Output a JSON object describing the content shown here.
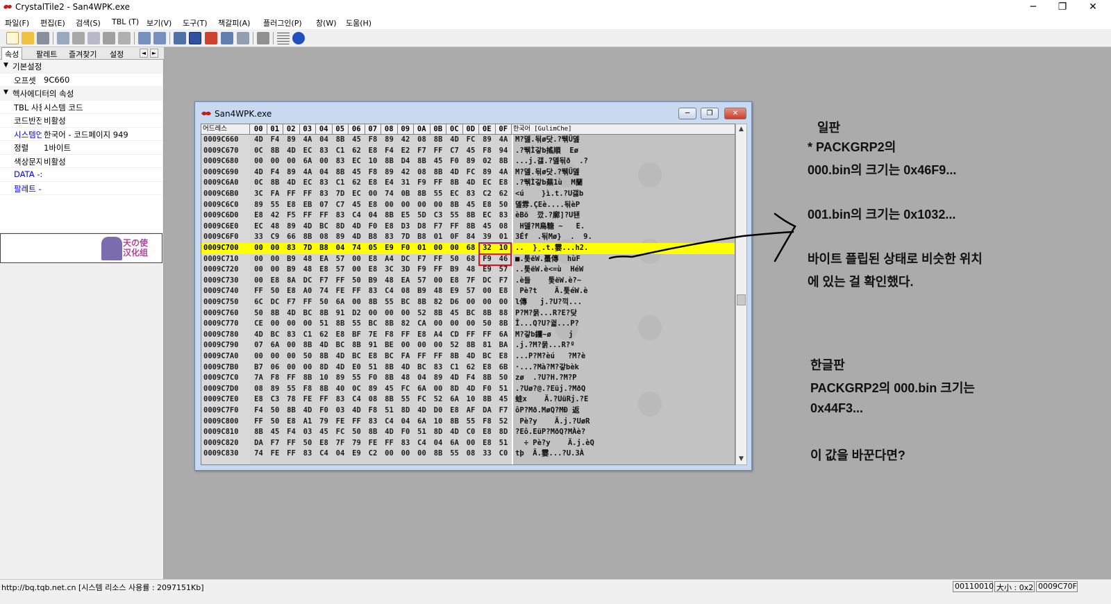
{
  "window": {
    "title": "CrystalTile2 - San4WPK.exe",
    "controls": [
      "─",
      "❐",
      "✕"
    ]
  },
  "menu": [
    "파일(F)",
    "편집(E)",
    "검색(S)",
    "TBL (T)",
    "보기(V)",
    "도구(T)",
    "책갈피(A)",
    "플러그인(P)",
    "창(W)",
    "도움(H)"
  ],
  "toolbar": {
    "icons": [
      "new-file-icon",
      "open-folder-icon",
      "save-icon",
      "undo-icon",
      "cut-icon",
      "copy-icon",
      "paste-icon",
      "delete-icon",
      "import-icon",
      "export-icon",
      "tile-view-icon",
      "hex-view-icon",
      "text-view-icon",
      "edit-icon",
      "search-icon",
      "print-icon",
      "grid-icon",
      "help-icon"
    ]
  },
  "left_panel": {
    "tabs": [
      "속성",
      "팔레트",
      "즐겨찾기",
      "설정"
    ],
    "tab_arrows": [
      "◄",
      "►"
    ],
    "rows": [
      {
        "type": "category",
        "label": "기본설정"
      },
      {
        "type": "prop",
        "key": "오프셋",
        "value": "9C660"
      },
      {
        "type": "category",
        "label": "헥사에디터의 속성"
      },
      {
        "type": "prop",
        "key": "TBL 사용",
        "value": "시스템 코드"
      },
      {
        "type": "prop",
        "key": "코드반전",
        "value": "비활성"
      },
      {
        "type": "prop",
        "key": "시스템언어",
        "value": "한국어    - 코드페이지 949",
        "link": true
      },
      {
        "type": "prop",
        "key": "정렬",
        "value": "1바이트"
      },
      {
        "type": "prop",
        "key": "색상문자",
        "value": "비활성"
      },
      {
        "type": "single",
        "key": "DATA -:",
        "link": true
      },
      {
        "type": "single",
        "key": "팔레트 -",
        "link": true
      }
    ],
    "logo_text": [
      "天の使",
      "汉化组"
    ]
  },
  "status": {
    "text": "http://bq.tqb.net.cn [시스템 리소스 사용률 : 2097151Kb]",
    "cells": [
      "00110010",
      "大小 : 0x2",
      "0009C70F"
    ]
  },
  "child_window": {
    "title": "San4WPK.exe",
    "header": {
      "address_label": "어드레스",
      "columns": [
        "00",
        "01",
        "02",
        "03",
        "04",
        "05",
        "06",
        "07",
        "08",
        "09",
        "0A",
        "0B",
        "0C",
        "0D",
        "0E",
        "0F"
      ],
      "text_label": "한국어 [GulimChe]"
    },
    "rows": [
      {
        "addr": "0009C660",
        "bytes": [
          "4D",
          "F4",
          "89",
          "4A",
          "04",
          "8B",
          "45",
          "F8",
          "89",
          "42",
          "08",
          "8B",
          "4D",
          "FC",
          "89",
          "4A"
        ],
        "text": "M?뎶.됚ø닷.?뛖Ü뎶"
      },
      {
        "addr": "0009C670",
        "bytes": [
          "0C",
          "8B",
          "4D",
          "EC",
          "83",
          "C1",
          "62",
          "E8",
          "F4",
          "E2",
          "F7",
          "FF",
          "C7",
          "45",
          "F8",
          "94"
        ],
        "text": ".?뛖Ì갛b搖順  Eø"
      },
      {
        "addr": "0009C680",
        "bytes": [
          "00",
          "00",
          "00",
          "6A",
          "00",
          "83",
          "EC",
          "10",
          "8B",
          "D4",
          "8B",
          "45",
          "F0",
          "89",
          "02",
          "8B"
        ],
        "text": "...j.갫.?뎶됚ð  .?"
      },
      {
        "addr": "0009C690",
        "bytes": [
          "4D",
          "F4",
          "89",
          "4A",
          "04",
          "8B",
          "45",
          "F8",
          "89",
          "42",
          "08",
          "8B",
          "4D",
          "FC",
          "89",
          "4A"
        ],
        "text": "M?뎶.됚ø닷.?뛖Ü뎶"
      },
      {
        "addr": "0009C6A0",
        "bytes": [
          "0C",
          "8B",
          "4D",
          "EC",
          "83",
          "C1",
          "62",
          "E8",
          "E4",
          "31",
          "F9",
          "FF",
          "8B",
          "4D",
          "EC",
          "E8"
        ],
        "text": ".?뛖Ì갛b蕪1ù  M蘭"
      },
      {
        "addr": "0009C6B0",
        "bytes": [
          "3C",
          "FA",
          "FF",
          "FF",
          "83",
          "7D",
          "EC",
          "00",
          "74",
          "0B",
          "8B",
          "55",
          "EC",
          "83",
          "C2",
          "62"
        ],
        "text": "<ú    }ì.t.?U갫b"
      },
      {
        "addr": "0009C6C0",
        "bytes": [
          "89",
          "55",
          "E8",
          "EB",
          "07",
          "C7",
          "45",
          "E8",
          "00",
          "00",
          "00",
          "00",
          "8B",
          "45",
          "E8",
          "50"
        ],
        "text": "뎶雰.ÇEè....됚èP"
      },
      {
        "addr": "0009C6D0",
        "bytes": [
          "E8",
          "42",
          "F5",
          "FF",
          "FF",
          "83",
          "C4",
          "04",
          "8B",
          "E5",
          "5D",
          "C3",
          "55",
          "8B",
          "EC",
          "83"
        ],
        "text": "èBõ  깠.?廓]?U됀"
      },
      {
        "addr": "0009C6E0",
        "bytes": [
          "EC",
          "48",
          "89",
          "4D",
          "BC",
          "8D",
          "4D",
          "F0",
          "E8",
          "D3",
          "D8",
          "F7",
          "FF",
          "8B",
          "45",
          "08"
        ],
        "text": " H뎶?M鳥糖 ~   E."
      },
      {
        "addr": "0009C6F0",
        "bytes": [
          "33",
          "C9",
          "66",
          "8B",
          "08",
          "89",
          "4D",
          "B8",
          "83",
          "7D",
          "B8",
          "01",
          "0F",
          "84",
          "39",
          "01"
        ],
        "text": "3Éf  .됚Mø}  .  9."
      },
      {
        "addr": "0009C700",
        "bytes": [
          "00",
          "00",
          "83",
          "7D",
          "B8",
          "04",
          "74",
          "05",
          "E9",
          "F0",
          "01",
          "00",
          "00",
          "68",
          "32",
          "10"
        ],
        "text": "..  }¸.t.霎...h2.",
        "hl": true
      },
      {
        "addr": "0009C710",
        "bytes": [
          "00",
          "00",
          "B9",
          "48",
          "EA",
          "57",
          "00",
          "E8",
          "A4",
          "DC",
          "F7",
          "FF",
          "50",
          "68",
          "F9",
          "46"
        ],
        "text": "■.퉃ëW.蠆傳  hùF"
      },
      {
        "addr": "0009C720",
        "bytes": [
          "00",
          "00",
          "B9",
          "48",
          "E8",
          "57",
          "00",
          "E8",
          "3C",
          "3D",
          "F9",
          "FF",
          "B9",
          "48",
          "E9",
          "57"
        ],
        "text": "..퉃ëW.è<=ù  HéW"
      },
      {
        "addr": "0009C730",
        "bytes": [
          "00",
          "E8",
          "8A",
          "DC",
          "F7",
          "FF",
          "50",
          "B9",
          "48",
          "EA",
          "57",
          "00",
          "E8",
          "7F",
          "DC",
          "F7"
        ],
        "text": ".è들    퉃ëW.è?~"
      },
      {
        "addr": "0009C740",
        "bytes": [
          "FF",
          "50",
          "E8",
          "A0",
          "74",
          "FE",
          "FF",
          "83",
          "C4",
          "08",
          "B9",
          "48",
          "E9",
          "57",
          "00",
          "E8"
        ],
        "text": " Pè?t    Ä.퉃éW.è"
      },
      {
        "addr": "0009C750",
        "bytes": [
          "6C",
          "DC",
          "F7",
          "FF",
          "50",
          "6A",
          "00",
          "8B",
          "55",
          "BC",
          "8B",
          "82",
          "D6",
          "00",
          "00",
          "00"
        ],
        "text": "l傳   j.?U?끽..."
      },
      {
        "addr": "0009C760",
        "bytes": [
          "50",
          "8B",
          "4D",
          "BC",
          "8B",
          "91",
          "D2",
          "00",
          "00",
          "00",
          "52",
          "8B",
          "45",
          "BC",
          "8B",
          "88"
        ],
        "text": "P?M?묽...R?E?닺"
      },
      {
        "addr": "0009C770",
        "bytes": [
          "CE",
          "00",
          "00",
          "00",
          "51",
          "8B",
          "55",
          "BC",
          "8B",
          "82",
          "CA",
          "00",
          "00",
          "00",
          "50",
          "8B"
        ],
        "text": "Î...Q?U?궓...P?"
      },
      {
        "addr": "0009C780",
        "bytes": [
          "4D",
          "BC",
          "83",
          "C1",
          "62",
          "E8",
          "BF",
          "7E",
          "F8",
          "FF",
          "E8",
          "A4",
          "CD",
          "FF",
          "FF",
          "6A"
        ],
        "text": "M?갛b钁~ø    j"
      },
      {
        "addr": "0009C790",
        "bytes": [
          "07",
          "6A",
          "00",
          "8B",
          "4D",
          "BC",
          "8B",
          "91",
          "BE",
          "00",
          "00",
          "00",
          "52",
          "8B",
          "81",
          "BA"
        ],
        "text": ".j.?M?묽...R?º"
      },
      {
        "addr": "0009C7A0",
        "bytes": [
          "00",
          "00",
          "00",
          "50",
          "8B",
          "4D",
          "BC",
          "E8",
          "BC",
          "FA",
          "FF",
          "FF",
          "8B",
          "4D",
          "BC",
          "E8"
        ],
        "text": "...P?M?èú   ?M?è"
      },
      {
        "addr": "0009C7B0",
        "bytes": [
          "B7",
          "06",
          "00",
          "00",
          "8D",
          "4D",
          "E0",
          "51",
          "8B",
          "4D",
          "BC",
          "83",
          "C1",
          "62",
          "E8",
          "6B"
        ],
        "text": "·...?Mà?M?갛bèk"
      },
      {
        "addr": "0009C7C0",
        "bytes": [
          "7A",
          "F8",
          "FF",
          "8B",
          "10",
          "89",
          "55",
          "F0",
          "8B",
          "48",
          "04",
          "89",
          "4D",
          "F4",
          "8B",
          "50"
        ],
        "text": "zø  .?U?H.?M?P"
      },
      {
        "addr": "0009C7D0",
        "bytes": [
          "08",
          "89",
          "55",
          "F8",
          "8B",
          "40",
          "0C",
          "89",
          "45",
          "FC",
          "6A",
          "00",
          "8D",
          "4D",
          "F0",
          "51"
        ],
        "text": ".?Uø?@.?Eüj.?MðQ"
      },
      {
        "addr": "0009C7E0",
        "bytes": [
          "E8",
          "C3",
          "78",
          "FE",
          "FF",
          "83",
          "C4",
          "08",
          "8B",
          "55",
          "FC",
          "52",
          "6A",
          "10",
          "8B",
          "45"
        ],
        "text": "蛙x    Ä.?UüRj.?E"
      },
      {
        "addr": "0009C7F0",
        "bytes": [
          "F4",
          "50",
          "8B",
          "4D",
          "F0",
          "03",
          "4D",
          "F8",
          "51",
          "8D",
          "4D",
          "D0",
          "E8",
          "AF",
          "DA",
          "F7"
        ],
        "text": "ôP?Mð.MøQ?MÐ 返"
      },
      {
        "addr": "0009C800",
        "bytes": [
          "FF",
          "50",
          "E8",
          "A1",
          "79",
          "FE",
          "FF",
          "83",
          "C4",
          "04",
          "6A",
          "10",
          "8B",
          "55",
          "F8",
          "52"
        ],
        "text": " Pè?y    Ä.j.?UøR"
      },
      {
        "addr": "0009C810",
        "bytes": [
          "8B",
          "45",
          "F4",
          "03",
          "45",
          "FC",
          "50",
          "8B",
          "4D",
          "F0",
          "51",
          "8D",
          "4D",
          "C0",
          "E8",
          "8D"
        ],
        "text": "?Eô.EüP?MðQ?MÀè?"
      },
      {
        "addr": "0009C820",
        "bytes": [
          "DA",
          "F7",
          "FF",
          "50",
          "E8",
          "7F",
          "79",
          "FE",
          "FF",
          "83",
          "C4",
          "04",
          "6A",
          "00",
          "E8",
          "51"
        ],
        "text": "  ÷ Pè?y    Ä.j.èQ"
      },
      {
        "addr": "0009C830",
        "bytes": [
          "74",
          "FE",
          "FF",
          "83",
          "C4",
          "04",
          "E9",
          "C2",
          "00",
          "00",
          "00",
          "8B",
          "55",
          "08",
          "33",
          "C0"
        ],
        "text": "tþ  Ä.霎...?U.3À"
      }
    ]
  },
  "annotations": {
    "jp_title": "일판",
    "jp_lines": [
      "* PACKGRP2의",
      "000.bin의 크기는 0x46F9...",
      "001.bin의 크기는 0x1032...",
      "바이트 플립된 상태로 비슷한 위치",
      "에 있는 걸 확인했다."
    ],
    "kr_title": "한글판",
    "kr_lines": [
      "PACKGRP2의 000.bin 크기는",
      "0x44F3...",
      "이 값을 바꾼다면?"
    ]
  },
  "colors": {
    "highlight_row": "#ffff00",
    "selection_blocks": "#7474f2",
    "mdi_background": "#ababab",
    "box_purple": "#c01060",
    "box_red": "#e01020"
  }
}
